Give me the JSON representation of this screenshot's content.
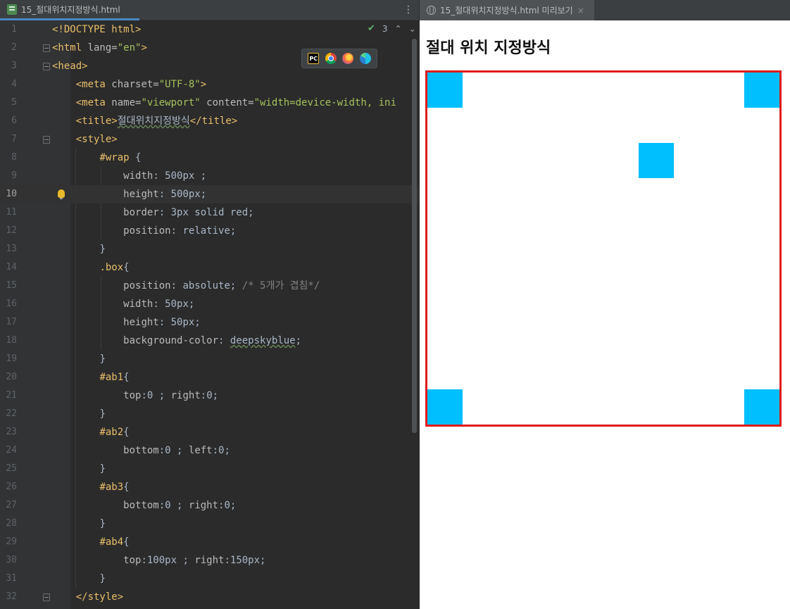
{
  "editor": {
    "tab_label": "15_절대위치지정방식.html",
    "tab_close": "×",
    "menu_glyph": "⋮",
    "status": {
      "check": "✔",
      "count": "3",
      "up": "⌃",
      "down": "⌄"
    },
    "browsers": [
      "PC",
      "chrome",
      "firefox",
      "edge"
    ],
    "current_line": 10,
    "lines": [
      {
        "n": "1",
        "segs": [
          [
            "t-tag",
            "<!DOCTYPE html>"
          ]
        ]
      },
      {
        "n": "2",
        "segs": [
          [
            "t-tag",
            "<html "
          ],
          [
            "t-attr",
            "lang="
          ],
          [
            "t-str",
            "\"en\""
          ],
          [
            "t-tag",
            ">"
          ]
        ]
      },
      {
        "n": "3",
        "segs": [
          [
            "t-tag",
            "<head>"
          ]
        ]
      },
      {
        "n": "4",
        "segs": [
          [
            "t-txt",
            "    "
          ],
          [
            "t-tag",
            "<meta "
          ],
          [
            "t-attr",
            "charset="
          ],
          [
            "t-str",
            "\"UTF-8\""
          ],
          [
            "t-tag",
            ">"
          ]
        ]
      },
      {
        "n": "5",
        "segs": [
          [
            "t-txt",
            "    "
          ],
          [
            "t-tag",
            "<meta "
          ],
          [
            "t-attr",
            "name="
          ],
          [
            "t-str",
            "\"viewport\""
          ],
          [
            "t-attr",
            " content="
          ],
          [
            "t-str",
            "\"width=device-width, ini"
          ]
        ]
      },
      {
        "n": "6",
        "segs": [
          [
            "t-txt",
            "    "
          ],
          [
            "t-tag",
            "<title>"
          ],
          [
            "t-txt wavy",
            "절대위치지정방식"
          ],
          [
            "t-tag",
            "</title>"
          ]
        ]
      },
      {
        "n": "7",
        "segs": [
          [
            "t-txt",
            "    "
          ],
          [
            "t-tag",
            "<style>"
          ]
        ]
      },
      {
        "n": "8",
        "segs": [
          [
            "t-txt",
            "        "
          ],
          [
            "t-sel",
            "#wrap "
          ],
          [
            "t-val",
            "{"
          ]
        ]
      },
      {
        "n": "9",
        "segs": [
          [
            "t-txt",
            "            "
          ],
          [
            "t-prop",
            "width"
          ],
          [
            "t-val",
            ": 500px ;"
          ]
        ]
      },
      {
        "n": "10",
        "segs": [
          [
            "t-txt",
            "            "
          ],
          [
            "t-prop",
            "height"
          ],
          [
            "t-val",
            ": 500px;"
          ]
        ]
      },
      {
        "n": "11",
        "segs": [
          [
            "t-txt",
            "            "
          ],
          [
            "t-prop",
            "border"
          ],
          [
            "t-val",
            ": 3px solid red;"
          ]
        ]
      },
      {
        "n": "12",
        "segs": [
          [
            "t-txt",
            "            "
          ],
          [
            "t-prop",
            "position"
          ],
          [
            "t-val",
            ": relative;"
          ]
        ]
      },
      {
        "n": "13",
        "segs": [
          [
            "t-txt",
            "        "
          ],
          [
            "t-val",
            "}"
          ]
        ]
      },
      {
        "n": "14",
        "segs": [
          [
            "t-txt",
            "        "
          ],
          [
            "t-sel",
            ".box"
          ],
          [
            "t-val",
            "{"
          ]
        ]
      },
      {
        "n": "15",
        "segs": [
          [
            "t-txt",
            "            "
          ],
          [
            "t-prop",
            "position"
          ],
          [
            "t-val",
            ": absolute; "
          ],
          [
            "t-cmt",
            "/* 5개가 겹침*/"
          ]
        ]
      },
      {
        "n": "16",
        "segs": [
          [
            "t-txt",
            "            "
          ],
          [
            "t-prop",
            "width"
          ],
          [
            "t-val",
            ": 50px;"
          ]
        ]
      },
      {
        "n": "17",
        "segs": [
          [
            "t-txt",
            "            "
          ],
          [
            "t-prop",
            "height"
          ],
          [
            "t-val",
            ": 50px;"
          ]
        ]
      },
      {
        "n": "18",
        "segs": [
          [
            "t-txt",
            "            "
          ],
          [
            "t-prop",
            "background-color"
          ],
          [
            "t-val",
            ": "
          ],
          [
            "t-val wavy",
            "deepskyblue"
          ],
          [
            "t-val",
            ";"
          ]
        ]
      },
      {
        "n": "19",
        "segs": [
          [
            "t-txt",
            "        "
          ],
          [
            "t-val",
            "}"
          ]
        ]
      },
      {
        "n": "20",
        "segs": [
          [
            "t-txt",
            "        "
          ],
          [
            "t-sel",
            "#ab1"
          ],
          [
            "t-val",
            "{"
          ]
        ]
      },
      {
        "n": "21",
        "segs": [
          [
            "t-txt",
            "            "
          ],
          [
            "t-prop",
            "top"
          ],
          [
            "t-val",
            ":0 ; "
          ],
          [
            "t-prop",
            "right"
          ],
          [
            "t-val",
            ":0;"
          ]
        ]
      },
      {
        "n": "22",
        "segs": [
          [
            "t-txt",
            "        "
          ],
          [
            "t-val",
            "}"
          ]
        ]
      },
      {
        "n": "23",
        "segs": [
          [
            "t-txt",
            "        "
          ],
          [
            "t-sel",
            "#ab2"
          ],
          [
            "t-val",
            "{"
          ]
        ]
      },
      {
        "n": "24",
        "segs": [
          [
            "t-txt",
            "            "
          ],
          [
            "t-prop",
            "bottom"
          ],
          [
            "t-val",
            ":0 ; "
          ],
          [
            "t-prop",
            "left"
          ],
          [
            "t-val",
            ":0;"
          ]
        ]
      },
      {
        "n": "25",
        "segs": [
          [
            "t-txt",
            "        "
          ],
          [
            "t-val",
            "}"
          ]
        ]
      },
      {
        "n": "26",
        "segs": [
          [
            "t-txt",
            "        "
          ],
          [
            "t-sel",
            "#ab3"
          ],
          [
            "t-val",
            "{"
          ]
        ]
      },
      {
        "n": "27",
        "segs": [
          [
            "t-txt",
            "            "
          ],
          [
            "t-prop",
            "bottom"
          ],
          [
            "t-val",
            ":0 ; "
          ],
          [
            "t-prop",
            "right"
          ],
          [
            "t-val",
            ":0;"
          ]
        ]
      },
      {
        "n": "28",
        "segs": [
          [
            "t-txt",
            "        "
          ],
          [
            "t-val",
            "}"
          ]
        ]
      },
      {
        "n": "29",
        "segs": [
          [
            "t-txt",
            "        "
          ],
          [
            "t-sel",
            "#ab4"
          ],
          [
            "t-val",
            "{"
          ]
        ]
      },
      {
        "n": "30",
        "segs": [
          [
            "t-txt",
            "            "
          ],
          [
            "t-prop",
            "top"
          ],
          [
            "t-val",
            ":100px ; "
          ],
          [
            "t-prop",
            "right"
          ],
          [
            "t-val",
            ":150px;"
          ]
        ]
      },
      {
        "n": "31",
        "segs": [
          [
            "t-txt",
            "        "
          ],
          [
            "t-val",
            "}"
          ]
        ]
      },
      {
        "n": "32",
        "segs": [
          [
            "t-txt",
            "    "
          ],
          [
            "t-tag",
            "</style>"
          ]
        ]
      }
    ]
  },
  "preview": {
    "tab_label": "15_절대위치지정방식.html 미리보기",
    "tab_close": "×",
    "page_heading": "절대 위치 지정방식",
    "colors": {
      "border": "#e01b1b",
      "box": "#00bfff"
    }
  }
}
